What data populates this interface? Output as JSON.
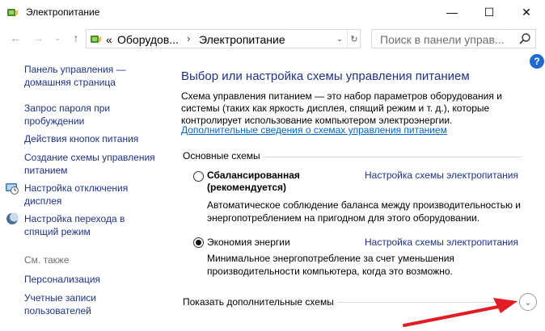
{
  "window": {
    "title": "Электропитание",
    "controls": {
      "minimize": "—",
      "maximize": "☐",
      "close": "✕"
    }
  },
  "nav": {
    "back": "←",
    "forward": "→",
    "dropdown": "⌄",
    "up": "↑"
  },
  "address": {
    "prefix": "«",
    "crumbs": [
      "Оборудов...",
      "Электропитание"
    ],
    "separator": "›",
    "dropdown": "⌄",
    "refresh": "↻"
  },
  "search": {
    "placeholder": "Поиск в панели управ..."
  },
  "sidebar": {
    "home_link": "Панель управления — домашняя страница",
    "links": [
      "Запрос пароля при пробуждении",
      "Действия кнопок питания",
      "Создание схемы управления питанием",
      "Настройка отключения дисплея",
      "Настройка перехода в спящий режим"
    ],
    "see_also_label": "См. также",
    "see_also_links": [
      "Персонализация",
      "Учетные записи пользователей"
    ]
  },
  "main": {
    "help": "?",
    "heading": "Выбор или настройка схемы управления питанием",
    "description": "Схема управления питанием — это набор параметров оборудования и системы (таких как яркость дисплея, спящий режим и т. д.), которые контролирует использование компьютером электроэнергии.",
    "details_link": "Дополнительные сведения о схемах управления питанием",
    "group_label": "Основные схемы",
    "plans": [
      {
        "name": "Сбалансированная (рекомендуется)",
        "selected": false,
        "link": "Настройка схемы электропитания",
        "description": "Автоматическое соблюдение баланса между производительностью и энергопотреблением на пригодном для этого оборудовании."
      },
      {
        "name": "Экономия энергии",
        "selected": true,
        "link": "Настройка схемы электропитания",
        "description": "Минимальное энергопотребление за счет уменьшения производительности компьютера, когда это возможно."
      }
    ],
    "more_label": "Показать дополнительные схемы",
    "expand_icon": "⌄"
  },
  "colors": {
    "link": "#1e3287",
    "hyperlink": "#0066cc",
    "annotation_arrow": "#e31b23",
    "help_badge": "#1f6bd0"
  }
}
